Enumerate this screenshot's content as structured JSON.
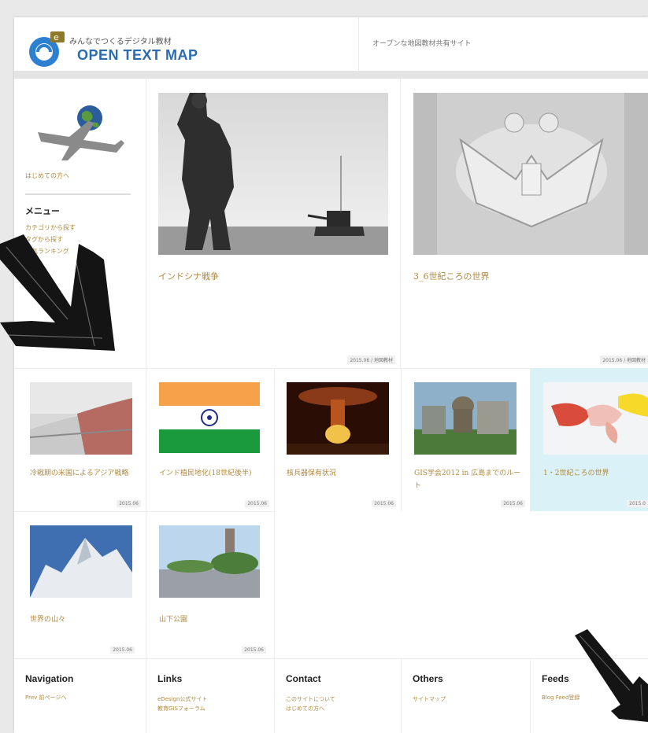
{
  "header": {
    "logo_sub": "みんなでつくるデジタル教材",
    "logo_title": "OPEN TEXT MAP",
    "tagline": "オープンな地図教材共有サイト"
  },
  "sidebar": {
    "intro_link": "はじめての方へ",
    "menu_title": "メニュー",
    "menu_items": [
      "カテゴリから探す",
      "タグから探す",
      "人気ランキング"
    ]
  },
  "cards": [
    {
      "title": "インドシナ戦争",
      "badge": "2015.06 / 地図教材"
    },
    {
      "title": "3_6世紀ころの世界",
      "badge": "2015.06 / 地図教材"
    },
    {
      "title": "冷戦期の米国によるアジア戦略",
      "badge": "2015.06"
    },
    {
      "title": "インド植民地化(18世紀後半)",
      "badge": "2015.06"
    },
    {
      "title": "核兵器保有状況",
      "badge": "2015.06"
    },
    {
      "title": "GIS学会2012 in 広島までのルート",
      "badge": "2015.06"
    },
    {
      "title": "1・2世紀ころの世界",
      "badge": "2015.0"
    },
    {
      "title": "世界の山々",
      "badge": "2015.06"
    },
    {
      "title": "山下公園",
      "badge": "2015.06"
    }
  ],
  "footer": {
    "navigation": {
      "title": "Navigation",
      "items": [
        "Prev 前ページへ"
      ]
    },
    "links": {
      "title": "Links",
      "items": [
        "eDesign公式サイト",
        "教育GISフォーラム"
      ]
    },
    "contact": {
      "title": "Contact",
      "items": [
        "このサイトについて",
        "はじめての方へ"
      ]
    },
    "others": {
      "title": "Others",
      "items": [
        "サイトマップ"
      ]
    },
    "feeds": {
      "title": "Feeds",
      "items": [
        "Blog Feed登録"
      ]
    }
  },
  "colors": {
    "link": "#b08a3e",
    "brand": "#2a6bb1",
    "highlight": "#dbf1f8"
  }
}
